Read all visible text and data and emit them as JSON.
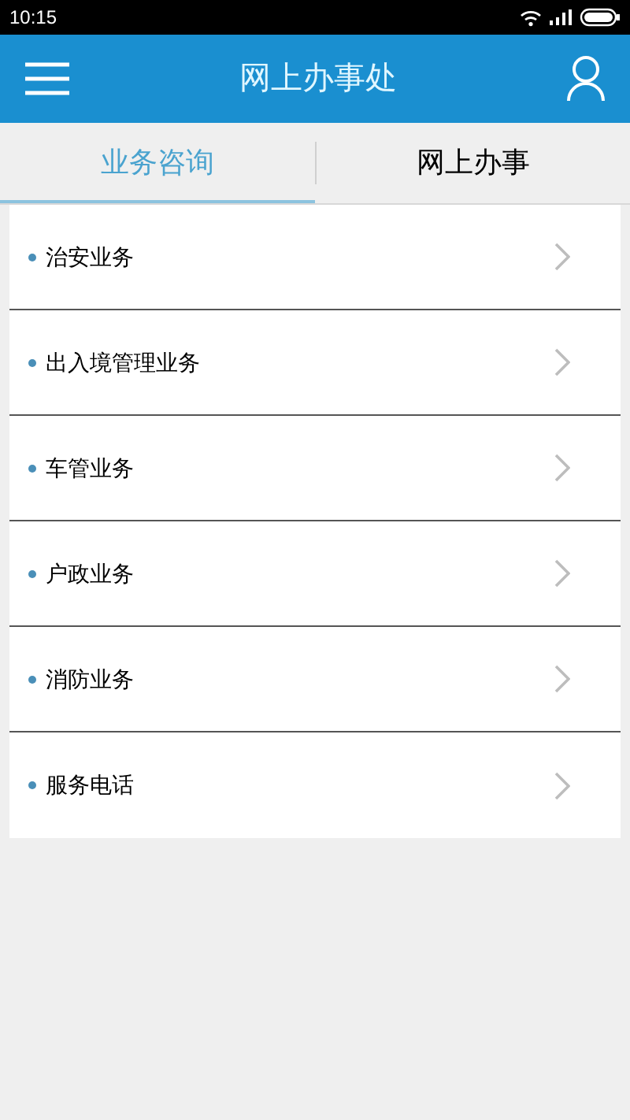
{
  "status_bar": {
    "time": "10:15"
  },
  "header": {
    "title": "网上办事处"
  },
  "tabs": [
    {
      "label": "业务咨询",
      "selected": true
    },
    {
      "label": "网上办事",
      "selected": false
    }
  ],
  "items": [
    {
      "label": "治安业务"
    },
    {
      "label": "出入境管理业务"
    },
    {
      "label": "车管业务"
    },
    {
      "label": "户政业务"
    },
    {
      "label": "消防业务"
    },
    {
      "label": "服务电话"
    }
  ]
}
